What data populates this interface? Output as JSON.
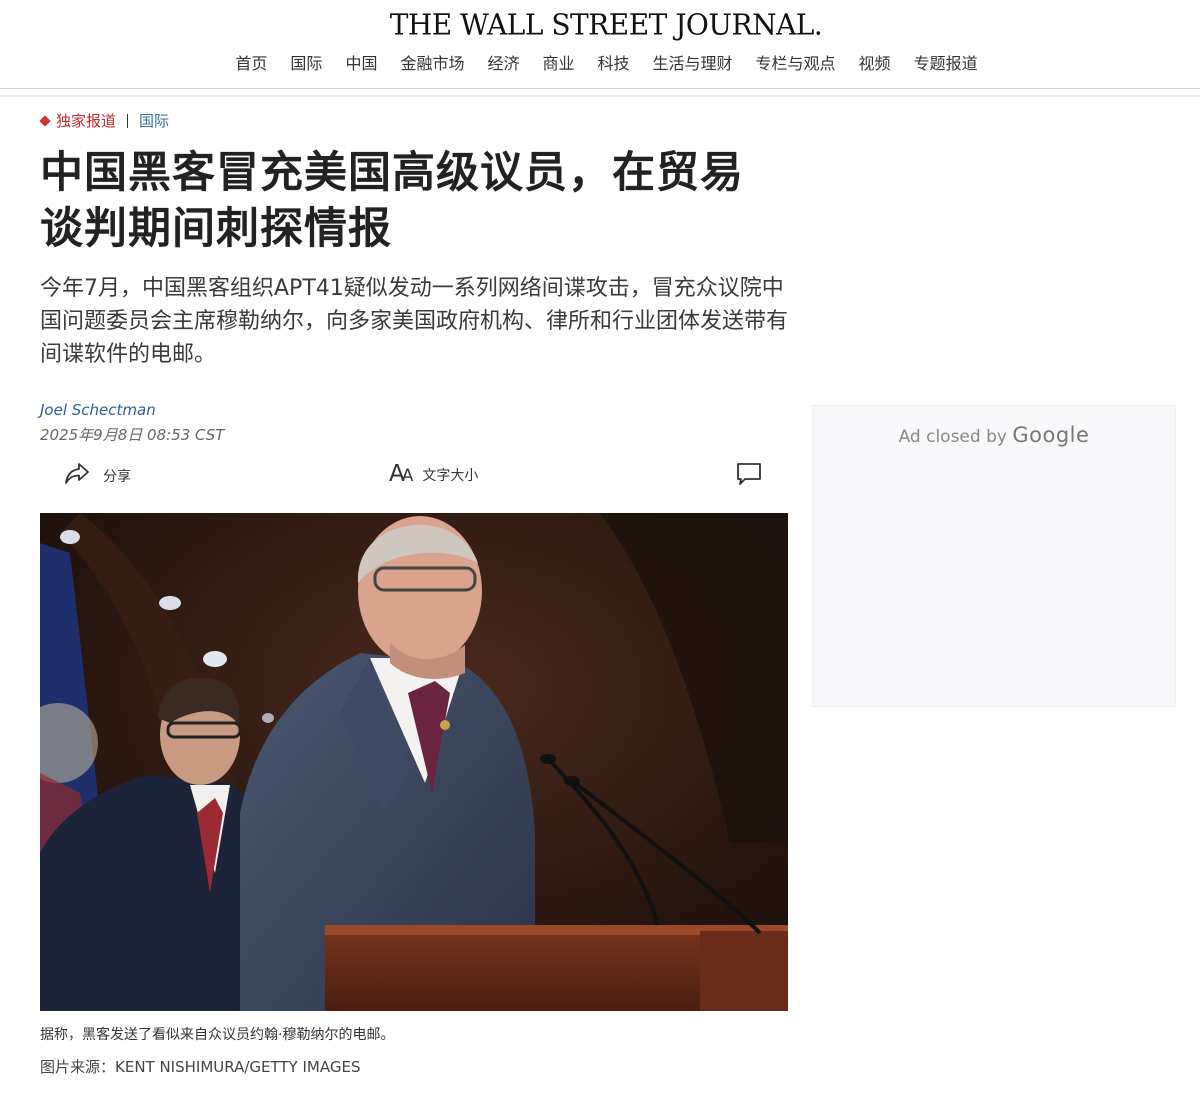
{
  "masthead": {
    "logo": "THE WALL STREET JOURNAL."
  },
  "nav": {
    "items": [
      {
        "label": "首页"
      },
      {
        "label": "国际"
      },
      {
        "label": "中国"
      },
      {
        "label": "金融市场"
      },
      {
        "label": "经济"
      },
      {
        "label": "商业"
      },
      {
        "label": "科技"
      },
      {
        "label": "生活与理财"
      },
      {
        "label": "专栏与观点"
      },
      {
        "label": "视频"
      },
      {
        "label": "专题报道"
      }
    ]
  },
  "article": {
    "kicker_exclusive": "独家报道",
    "kicker_section": "国际",
    "headline": "中国黑客冒充美国高级议员，在贸易谈判期间刺探情报",
    "dek": "今年7月，中国黑客组织APT41疑似发动一系列网络间谍攻击，冒充众议院中国问题委员会主席穆勒纳尔，向多家美国政府机构、律所和行业团体发送带有间谍软件的电邮。",
    "byline": "Joel Schectman",
    "timestamp": "2025年9月8日 08:53 CST",
    "toolbar": {
      "share_label": "分享",
      "text_size_label": "文字大小"
    },
    "caption": "据称，黑客发送了看似来自众议员约翰·穆勒纳尔的电邮。",
    "credit": "图片来源：KENT NISHIMURA/GETTY IMAGES"
  },
  "ad": {
    "closed_text": "Ad closed by",
    "brand": "Google"
  },
  "colors": {
    "kicker_red": "#c4272c",
    "link_blue": "#2b5c9c"
  }
}
